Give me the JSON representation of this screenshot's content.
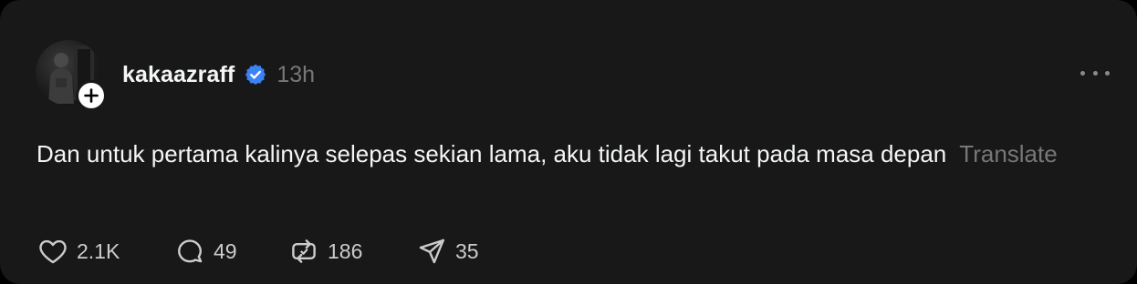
{
  "post": {
    "author": {
      "username": "kakaazraff",
      "verified": true,
      "avatar_icon": "profile-photo",
      "follow_icon": "plus-icon"
    },
    "timestamp": "13h",
    "text": "Dan untuk pertama kalinya selepas sekian lama, aku tidak lagi takut pada masa depan",
    "translate_label": "Translate",
    "menu_icon": "more-horizontal-icon"
  },
  "actions": {
    "like": {
      "icon": "heart-icon",
      "count": "2.1K"
    },
    "reply": {
      "icon": "comment-icon",
      "count": "49"
    },
    "repost": {
      "icon": "repost-icon",
      "count": "186"
    },
    "share": {
      "icon": "send-icon",
      "count": "35"
    }
  },
  "colors": {
    "background": "#181818",
    "text_primary": "#f3f5f7",
    "text_secondary": "#777777",
    "verified_blue": "#3b82f6"
  }
}
